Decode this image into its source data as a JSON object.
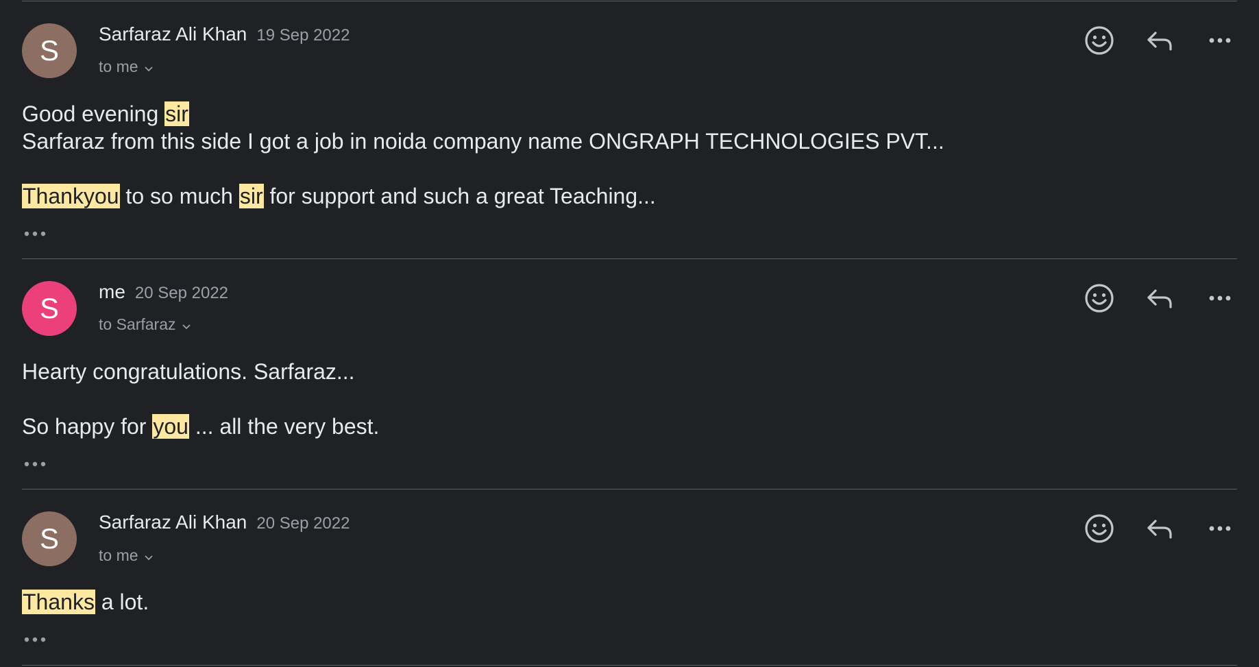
{
  "messages": [
    {
      "sender": "Sarfaraz Ali Khan",
      "date": "19 Sep 2022",
      "recipient": "to me",
      "avatar_letter": "S",
      "avatar_color": "#8d6e63",
      "lines": [
        [
          {
            "t": "Good evening "
          },
          {
            "t": "sir",
            "hl": true
          }
        ],
        [
          {
            "t": "Sarfaraz from this side I got a job in noida company name ONGRAPH TECHNOLOGIES PVT..."
          }
        ],
        [
          {
            "t": "Thankyou",
            "hl": true
          },
          {
            "t": " to so much "
          },
          {
            "t": "sir",
            "hl": true
          },
          {
            "t": " for support and such a great Teaching..."
          }
        ]
      ]
    },
    {
      "sender": "me",
      "date": "20 Sep 2022",
      "recipient": "to Sarfaraz",
      "avatar_letter": "S",
      "avatar_color": "#ec407a",
      "lines": [
        [
          {
            "t": "Hearty congratulations. Sarfaraz..."
          }
        ],
        [
          {
            "t": "So happy for "
          },
          {
            "t": "you",
            "hl": true
          },
          {
            "t": " ... all the very best."
          }
        ]
      ]
    },
    {
      "sender": "Sarfaraz Ali Khan",
      "date": "20 Sep 2022",
      "recipient": "to me",
      "avatar_letter": "S",
      "avatar_color": "#8d6e63",
      "lines": [
        [
          {
            "t": "Thanks",
            "hl": true
          },
          {
            "t": " a lot."
          }
        ]
      ]
    }
  ],
  "icons": {
    "react": "emoji-smile-icon",
    "reply": "reply-icon",
    "more": "more-horizontal-icon",
    "expand": "show-trimmed-content-icon",
    "recipient_toggle": "chevron-down-icon"
  },
  "colors": {
    "background": "#202124",
    "highlight": "#fce8a0",
    "divider": "#5f6368",
    "secondary_text": "#9aa0a6"
  }
}
